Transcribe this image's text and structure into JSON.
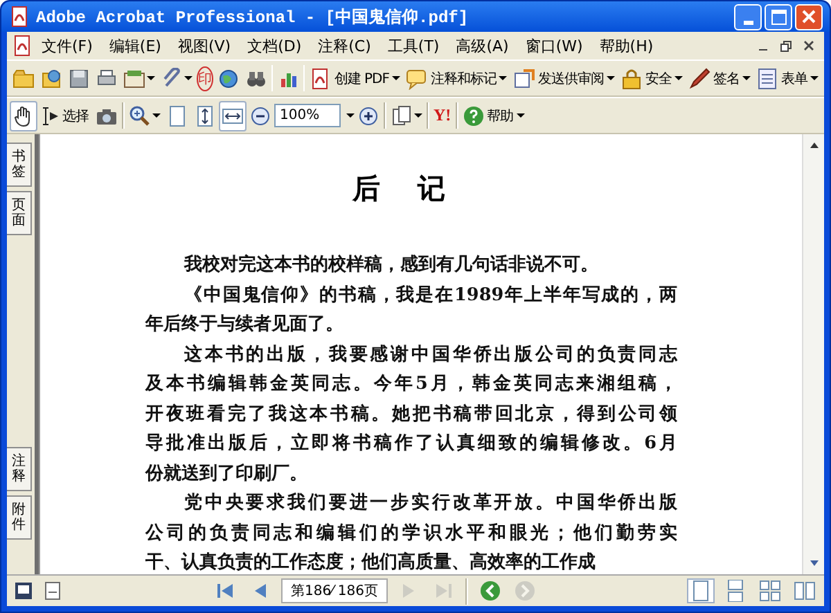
{
  "window": {
    "title": "Adobe Acrobat Professional - [中国鬼信仰.pdf]"
  },
  "menu": [
    "文件(F)",
    "编辑(E)",
    "视图(V)",
    "文档(D)",
    "注释(C)",
    "工具(T)",
    "高级(A)",
    "窗口(W)",
    "帮助(H)"
  ],
  "toolbar_1": [
    {
      "kind": "icon"
    },
    {
      "kind": "icon"
    },
    {
      "kind": "icon"
    },
    {
      "kind": "icon"
    },
    {
      "kind": "icon-menu"
    },
    {
      "kind": "icon-menu"
    },
    {
      "kind": "stamp",
      "label": "印"
    },
    {
      "kind": "icon"
    },
    {
      "kind": "icon"
    },
    {
      "kind": "icon"
    },
    {
      "kind": "menu-button",
      "label": "创建 PDF"
    },
    {
      "kind": "menu-button",
      "label": "注释和标记"
    },
    {
      "kind": "menu-button",
      "label": "发送供审阅"
    },
    {
      "kind": "menu-button",
      "label": "安全"
    },
    {
      "kind": "menu-button",
      "label": "签名"
    },
    {
      "kind": "menu-button",
      "label": "表单"
    }
  ],
  "toolbar_2": [
    {
      "kind": "tool",
      "selected": true
    },
    {
      "kind": "text-tool",
      "label": "选择",
      "selected": false
    },
    {
      "kind": "tool",
      "selected": false
    },
    {
      "kind": "icon-menu",
      "selected": false
    },
    {
      "kind": "tool",
      "selected": false
    },
    {
      "kind": "tool",
      "selected": false
    },
    {
      "kind": "tool",
      "selected": true
    },
    {
      "kind": "tool",
      "selected": false
    },
    {
      "kind": "zoom",
      "value": "100%"
    },
    {
      "kind": "tool",
      "selected": false
    },
    {
      "kind": "icon-menu",
      "selected": false
    },
    {
      "kind": "logo",
      "label": "Y!"
    },
    {
      "kind": "menu-button",
      "label": "帮助",
      "selected": false
    }
  ],
  "side_tabs": [
    "书签",
    "页面",
    "注释",
    "附件"
  ],
  "document": {
    "title": "后 记",
    "paragraphs": [
      {
        "lines": [
          "我校对完这本书的校样稿，感到有几句话非说不可。"
        ]
      },
      {
        "lines": [
          "《中国鬼信仰》的书稿，我是在1989年上半年写成的，两",
          "年后终于与续者见面了。"
        ]
      },
      {
        "lines": [
          "这本书的出版，我要感谢中国华侨出版公司的负责同志",
          "及本书编辑韩金英同志。今年5月，韩金英同志来湘组稿，",
          "开夜班看完了我这本书稿。她把书稿带回北京，得到公司领",
          "导批准出版后，立即将书稿作了认真细致的编辑修改。6月",
          "份就送到了印刷厂。"
        ]
      },
      {
        "lines": [
          "党中央要求我们要进一步实行改革开放。中国华侨出版",
          "公司的负责同志和编辑们的学识水平和眼光；他们勤劳实",
          "干、认真负责的工作态度；他们高质量、高效率的工作成"
        ]
      }
    ]
  },
  "status_bar": {
    "nav": [
      {
        "disabled": false
      },
      {
        "disabled": false
      },
      {
        "kind": "page",
        "value": "第186⁄ 186页"
      },
      {
        "disabled": true
      },
      {
        "disabled": true
      },
      {
        "kind": "gap"
      },
      {
        "disabled": false
      },
      {
        "disabled": true
      }
    ],
    "layouts": [
      {
        "selected": true
      },
      {
        "selected": false
      },
      {
        "selected": false
      },
      {
        "selected": false
      }
    ]
  }
}
